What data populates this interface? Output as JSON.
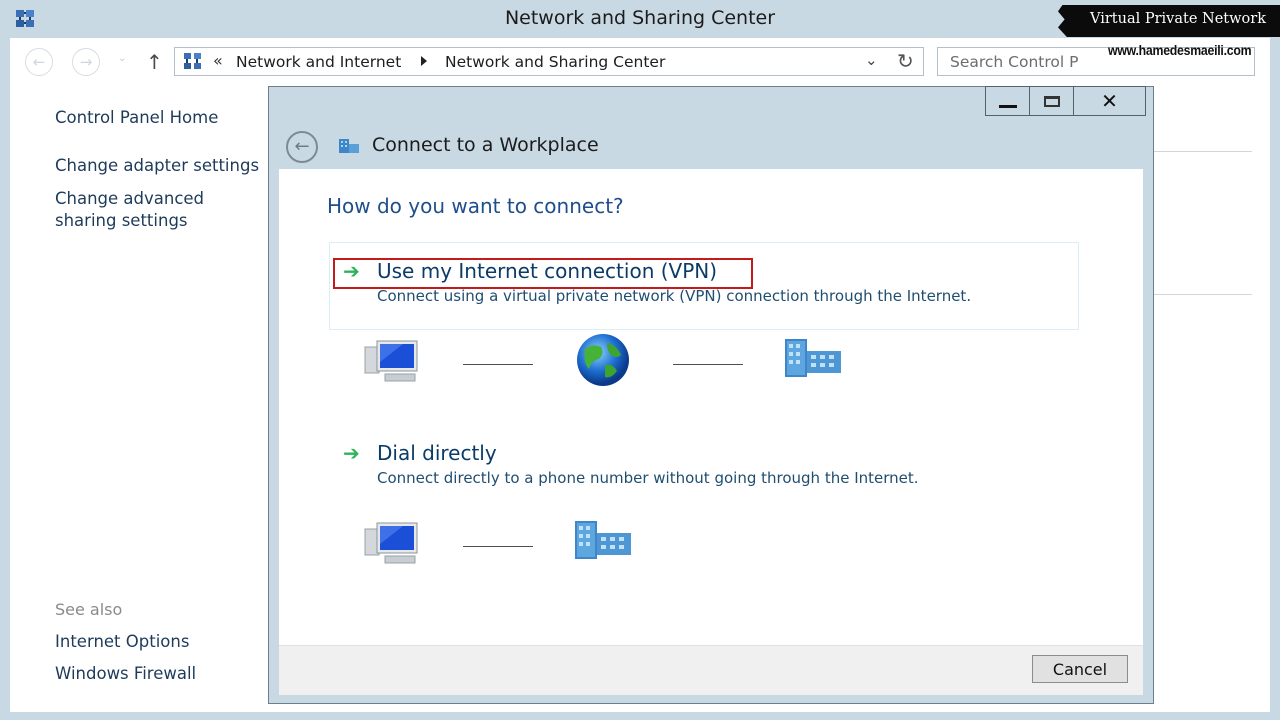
{
  "window": {
    "title": "Network and Sharing Center"
  },
  "watermark": {
    "title": "Virtual Private Network",
    "url": "www.hamedesmaeili.com"
  },
  "address": {
    "chevron": "«",
    "crumbs": [
      "Network and Internet",
      "Network and Sharing Center"
    ]
  },
  "search": {
    "placeholder": "Search Control P"
  },
  "sidebar": {
    "links": [
      "Control Panel Home",
      "Change adapter settings",
      "Change advanced sharing settings"
    ],
    "see_also_label": "See also",
    "see_also": [
      "Internet Options",
      "Windows Firewall"
    ]
  },
  "dialog": {
    "title": "Connect to a Workplace",
    "question": "How do you want to connect?",
    "options": [
      {
        "title": "Use my Internet connection (VPN)",
        "description": "Connect using a virtual private network (VPN) connection through the Internet.",
        "highlighted": true,
        "diagram": [
          "computer-icon",
          "globe-icon",
          "server-icon"
        ]
      },
      {
        "title": "Dial directly",
        "description": "Connect directly to a phone number without going through the Internet.",
        "highlighted": false,
        "diagram": [
          "computer-icon",
          "server-icon"
        ]
      }
    ],
    "cancel_label": "Cancel"
  },
  "colors": {
    "chrome": "#c9d9e3",
    "heading_blue": "#1f4e8c",
    "highlight_red": "#c21b1b",
    "arrow_green": "#2eb35b"
  },
  "glyphs": {
    "back": "←",
    "forward": "→",
    "up": "↑",
    "dropdown": "⌄",
    "refresh": "↻",
    "close": "✕",
    "green_arrow": "➔"
  }
}
